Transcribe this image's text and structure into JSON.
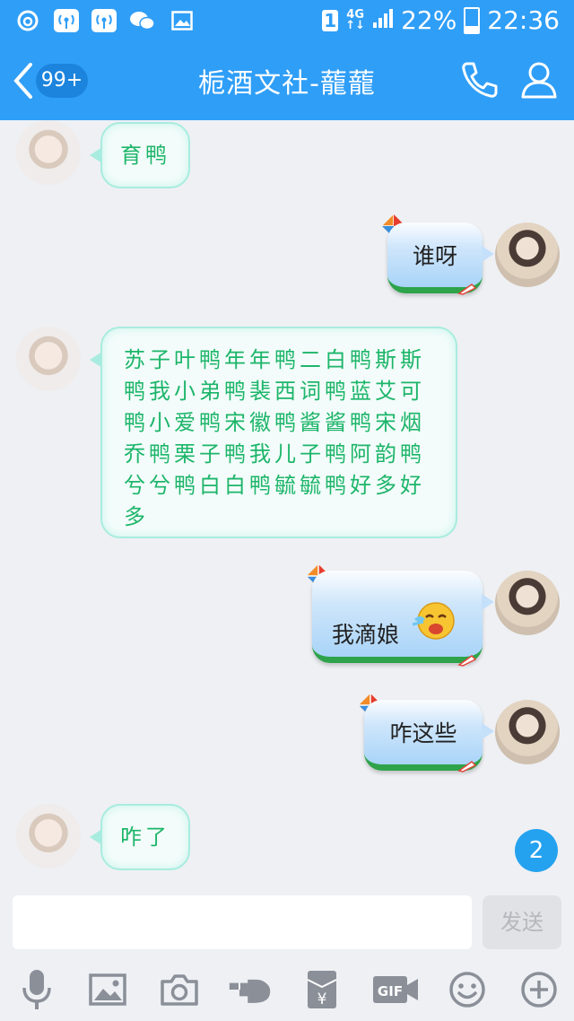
{
  "status_bar": {
    "sim_label": "1",
    "network_top": "4G",
    "network_bottom": "↑↓",
    "battery": "22%",
    "time": "22:36"
  },
  "nav": {
    "unread_badge": "99+",
    "title": "栀酒文社-蘢蘢"
  },
  "messages": [
    {
      "side": "in",
      "text": "育鸭"
    },
    {
      "side": "out",
      "text": "谁呀"
    },
    {
      "side": "in",
      "text": "苏子叶鸭年年鸭二白鸭斯斯鸭我小弟鸭裴西词鸭蓝艾可鸭小爱鸭宋徽鸭酱酱鸭宋烟乔鸭栗子鸭我儿子鸭阿韵鸭兮兮鸭白白鸭毓毓鸭好多好多"
    },
    {
      "side": "out",
      "text": "我滴娘"
    },
    {
      "side": "out",
      "text": "咋这些"
    },
    {
      "side": "in",
      "text": "咋了"
    }
  ],
  "unread_count": "2",
  "composer": {
    "input_value": "",
    "send_label": "发送"
  },
  "toolbar_icons": [
    "mic-icon",
    "image-icon",
    "camera-icon",
    "hand-point-icon",
    "red-packet-icon",
    "gif-icon",
    "emoji-icon",
    "plus-icon"
  ],
  "colors": {
    "header_blue": "#2f9ef7",
    "incoming_text_green": "#1db56a",
    "unread_badge_blue": "#24a2ef"
  }
}
